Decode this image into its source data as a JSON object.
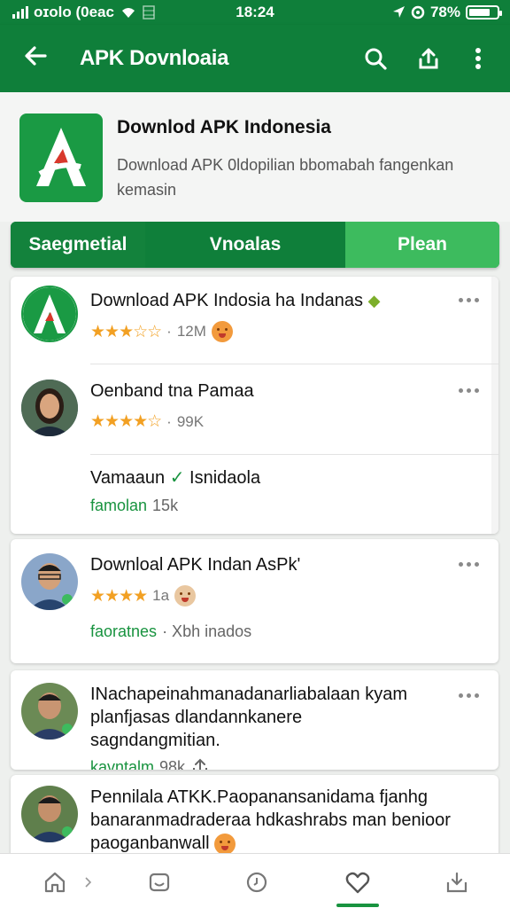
{
  "status": {
    "carrier": "ᴏɪᴏlo (0eac",
    "time": "18:24",
    "battery": "78%",
    "battery_level": 0.78
  },
  "appbar": {
    "title": "APK Dovnloaia"
  },
  "hero": {
    "title": "Downlod APK Indonesia",
    "description": "Download APK 0ldopilian bbomabah fangenkan kemasin"
  },
  "segments": [
    "Saegmetial",
    "Vnoalas",
    "Plean"
  ],
  "items": [
    {
      "title": "Download APK Indosia ha Indanas",
      "rating_text": "12M",
      "rating": 3.5
    },
    {
      "title": "Oenband tna Pamaa",
      "rating_text": "99K",
      "rating": 3.5,
      "sub_title": "Vamaaun",
      "sub_title_2": "Isnidaola",
      "sub_tag": "famolan",
      "sub_count": "15k"
    },
    {
      "title": "Downloal APK Indan AsPk'",
      "rating_text": "1a",
      "rating": 4,
      "sub_tag": "faoratnes",
      "sub_meta": "· Xbh inados"
    },
    {
      "title": "INachapeinahmanadanarliabalaan kyam planfjasas dlandannkanere sagndangmitian.",
      "sub_tag": "kavntalm",
      "sub_count": "98k"
    },
    {
      "title": "Pennilala ATKK.Paopanansanidama fjanhg banaranmadraderaa hdkashrabs man benioor paoganbanwall"
    }
  ],
  "colors": {
    "brand_green": "#0f7f3a",
    "accent_green": "#3dbb5e",
    "star": "#f2a023"
  }
}
